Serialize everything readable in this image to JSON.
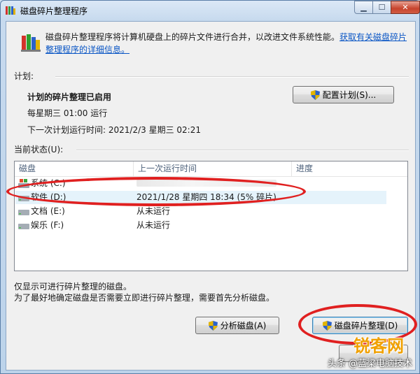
{
  "window": {
    "title": "磁盘碎片整理程序"
  },
  "intro": {
    "text": "磁盘碎片整理程序将计算机硬盘上的碎片文件进行合并，以改进文件系统性能。",
    "link": "获取有关磁盘碎片整理程序的详细信息。"
  },
  "schedule": {
    "label": "计划:",
    "status": "计划的碎片整理已启用",
    "frequency": "每星期三  01:00 运行",
    "next_run": "下一次计划运行时间: 2021/2/3 星期三 02:21",
    "configure_button": "配置计划(S)..."
  },
  "current": {
    "label": "当前状态(U):",
    "columns": [
      "磁盘",
      "上一次运行时间",
      "进度"
    ],
    "rows": [
      {
        "name": "系统 (C:)",
        "last": ""
      },
      {
        "name": "软件 (D:)",
        "last": "2021/1/28 星期四 18:34 (5% 碎片)"
      },
      {
        "name": "文档 (E:)",
        "last": "从未运行"
      },
      {
        "name": "娱乐 (F:)",
        "last": "从未运行"
      }
    ]
  },
  "notes": {
    "line1": "仅显示可进行碎片整理的磁盘。",
    "line2": "为了最好地确定磁盘是否需要立即进行碎片整理，需要首先分析磁盘。"
  },
  "buttons": {
    "analyze": "分析磁盘(A)",
    "defragment": "磁盘碎片整理(D)"
  },
  "watermark": {
    "brand": "锐客网",
    "credit": "头条 @蓝梁电脑技术"
  },
  "colors": {
    "accent_link": "#0a56c5",
    "highlight": "#e02020"
  }
}
